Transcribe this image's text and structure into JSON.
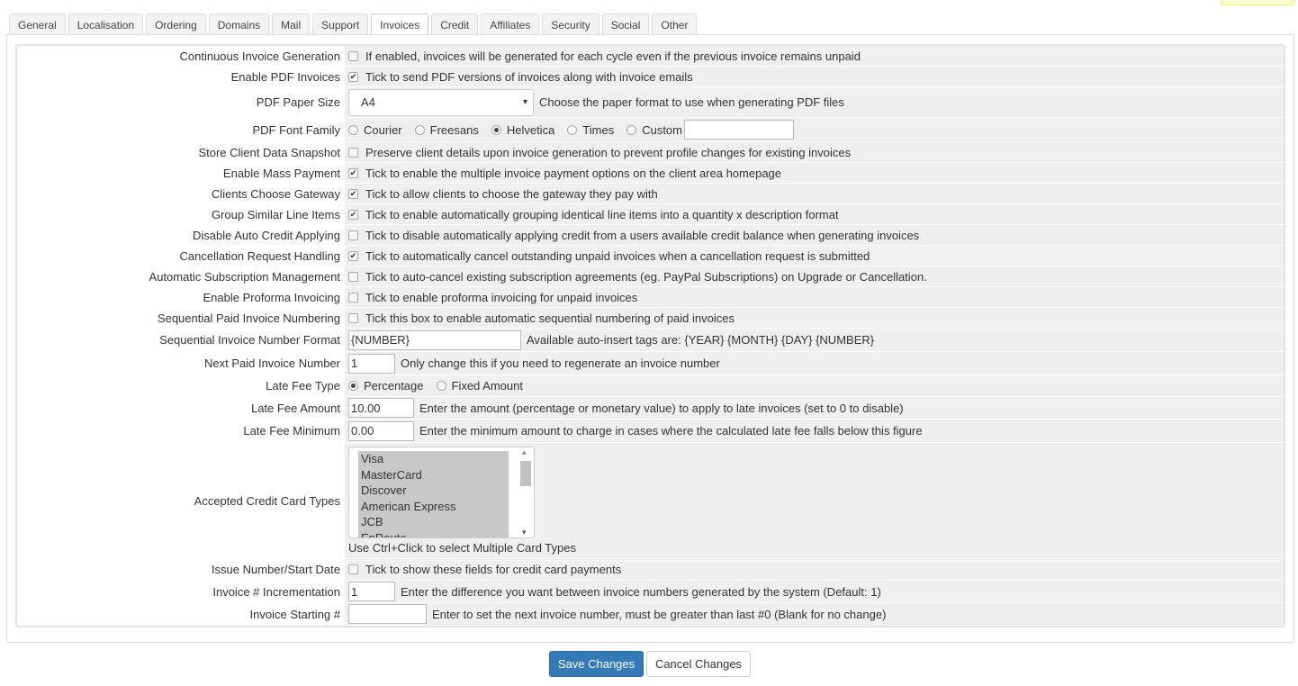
{
  "tabs": [
    "General",
    "Localisation",
    "Ordering",
    "Domains",
    "Mail",
    "Support",
    "Invoices",
    "Credit",
    "Affiliates",
    "Security",
    "Social",
    "Other"
  ],
  "active_tab": "Invoices",
  "rows": [
    {
      "id": "continuous",
      "label": "Continuous Invoice Generation",
      "type": "checkbox",
      "checked": false,
      "help": "If enabled, invoices will be generated for each cycle even if the previous invoice remains unpaid"
    },
    {
      "id": "pdf",
      "label": "Enable PDF Invoices",
      "type": "checkbox",
      "checked": true,
      "help": "Tick to send PDF versions of invoices along with invoice emails"
    },
    {
      "id": "papersize",
      "label": "PDF Paper Size",
      "type": "select",
      "value": "A4",
      "help": "Choose the paper format to use when generating PDF files"
    },
    {
      "id": "font",
      "label": "PDF Font Family",
      "type": "radio",
      "options": [
        "Courier",
        "Freesans",
        "Helvetica",
        "Times",
        "Custom"
      ],
      "selected": "Helvetica",
      "extra_input": ""
    },
    {
      "id": "snapshot",
      "label": "Store Client Data Snapshot",
      "type": "checkbox",
      "checked": false,
      "help": "Preserve client details upon invoice generation to prevent profile changes for existing invoices"
    },
    {
      "id": "masspay",
      "label": "Enable Mass Payment",
      "type": "checkbox",
      "checked": true,
      "help": "Tick to enable the multiple invoice payment options on the client area homepage"
    },
    {
      "id": "gateway",
      "label": "Clients Choose Gateway",
      "type": "checkbox",
      "checked": true,
      "help": "Tick to allow clients to choose the gateway they pay with"
    },
    {
      "id": "group",
      "label": "Group Similar Line Items",
      "type": "checkbox",
      "checked": true,
      "help": "Tick to enable automatically grouping identical line items into a quantity x description format"
    },
    {
      "id": "autocredit",
      "label": "Disable Auto Credit Applying",
      "type": "checkbox",
      "checked": false,
      "help": "Tick to disable automatically applying credit from a users available credit balance when generating invoices"
    },
    {
      "id": "cancelreq",
      "label": "Cancellation Request Handling",
      "type": "checkbox",
      "checked": true,
      "help": "Tick to automatically cancel outstanding unpaid invoices when a cancellation request is submitted"
    },
    {
      "id": "subs",
      "label": "Automatic Subscription Management",
      "type": "checkbox",
      "checked": false,
      "help": "Tick to auto-cancel existing subscription agreements (eg. PayPal Subscriptions) on Upgrade or Cancellation."
    },
    {
      "id": "proforma",
      "label": "Enable Proforma Invoicing",
      "type": "checkbox",
      "checked": false,
      "help": "Tick to enable proforma invoicing for unpaid invoices"
    },
    {
      "id": "seqpaid",
      "label": "Sequential Paid Invoice Numbering",
      "type": "checkbox",
      "checked": false,
      "help": "Tick this box to enable automatic sequential numbering of paid invoices"
    },
    {
      "id": "seqfmt",
      "label": "Sequential Invoice Number Format",
      "type": "text",
      "value": "{NUMBER}",
      "help": "Available auto-insert tags are: {YEAR} {MONTH} {DAY} {NUMBER}"
    },
    {
      "id": "nextpaid",
      "label": "Next Paid Invoice Number",
      "type": "text",
      "value": "1",
      "help": "Only change this if you need to regenerate an invoice number"
    },
    {
      "id": "latetype",
      "label": "Late Fee Type",
      "type": "radio",
      "options": [
        "Percentage",
        "Fixed Amount"
      ],
      "selected": "Percentage"
    },
    {
      "id": "lateamt",
      "label": "Late Fee Amount",
      "type": "text",
      "value": "10.00",
      "help": "Enter the amount (percentage or monetary value) to apply to late invoices (set to 0 to disable)"
    },
    {
      "id": "latemin",
      "label": "Late Fee Minimum",
      "type": "text",
      "value": "0.00",
      "help": "Enter the minimum amount to charge in cases where the calculated late fee falls below this figure"
    },
    {
      "id": "cards",
      "label": "Accepted Credit Card Types",
      "type": "multiselect",
      "options": [
        "Visa",
        "MasterCard",
        "Discover",
        "American Express",
        "JCB",
        "EnRoute"
      ],
      "help": "Use Ctrl+Click to select Multiple Card Types"
    },
    {
      "id": "issue",
      "label": "Issue Number/Start Date",
      "type": "checkbox",
      "checked": false,
      "help": "Tick to show these fields for credit card payments"
    },
    {
      "id": "incr",
      "label": "Invoice # Incrementation",
      "type": "text",
      "value": "1",
      "help": "Enter the difference you want between invoice numbers generated by the system (Default: 1)"
    },
    {
      "id": "start",
      "label": "Invoice Starting #",
      "type": "text",
      "value": "",
      "help": "Enter to set the next invoice number, must be greater than last #0 (Blank for no change)"
    }
  ],
  "buttons": {
    "save": "Save Changes",
    "cancel": "Cancel Changes"
  }
}
